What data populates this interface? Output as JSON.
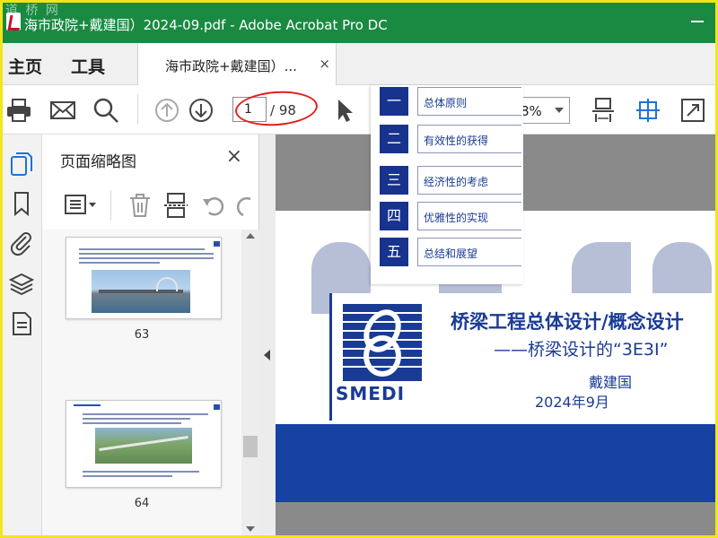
{
  "window": {
    "title": "海市政院+戴建国）2024-09.pdf - Adobe Acrobat Pro DC",
    "watermark": "道 桥 网"
  },
  "menubar": {
    "home_label": "主页",
    "tools_label": "工具",
    "doc_tab_label": "海市政院+戴建国）...",
    "doc_tab_close": "×"
  },
  "toolbar": {
    "current_page": "1",
    "total_pages": "/ 98",
    "zoom": "8%"
  },
  "thumbnail_panel": {
    "title": "页面缩略图",
    "close": "×",
    "thumbnails": [
      {
        "page_number": "63"
      },
      {
        "page_number": "64"
      }
    ]
  },
  "document": {
    "title": "桥梁工程总体设计/概念设计",
    "subtitle": "——桥梁设计的“3E3I”",
    "author": "戴建国",
    "date": "2024年9月",
    "logo_text": "SMEDI"
  },
  "contents": [
    {
      "num": "一",
      "label": "总体原则"
    },
    {
      "num": "二",
      "label": "有效性的获得"
    },
    {
      "num": "三",
      "label": "经济性的考虑"
    },
    {
      "num": "四",
      "label": "优雅性的实现"
    },
    {
      "num": "五",
      "label": "总结和展望"
    }
  ],
  "colors": {
    "titlebar": "#1a8a43",
    "brand_blue": "#1a3b94",
    "annotation_red": "#e0201c",
    "screen_border": "#f3e51a"
  }
}
